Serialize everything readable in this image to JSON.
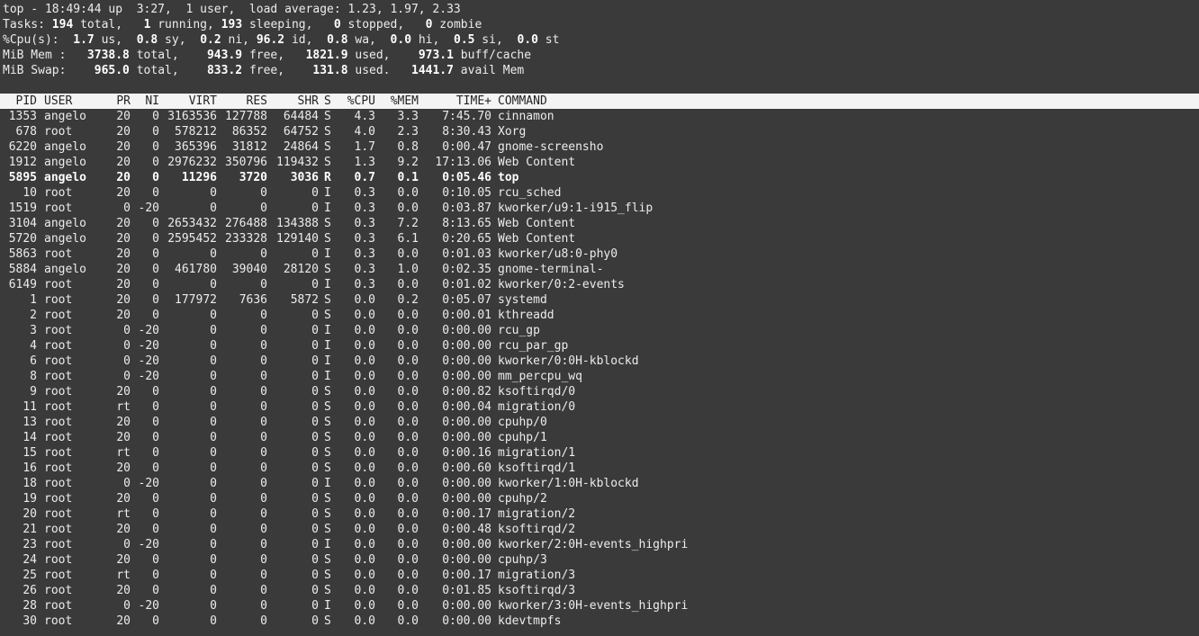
{
  "summary": {
    "top": "top - 18:49:44 up  3:27,  1 user,  load average: 1.23, 1.97, 2.33",
    "tasks": [
      {
        "t": "Tasks: ",
        "b": false
      },
      {
        "t": "194",
        "b": true
      },
      {
        "t": " total,   ",
        "b": false
      },
      {
        "t": "1",
        "b": true
      },
      {
        "t": " running, ",
        "b": false
      },
      {
        "t": "193",
        "b": true
      },
      {
        "t": " sleeping,   ",
        "b": false
      },
      {
        "t": "0",
        "b": true
      },
      {
        "t": " stopped,   ",
        "b": false
      },
      {
        "t": "0",
        "b": true
      },
      {
        "t": " zombie",
        "b": false
      }
    ],
    "cpu": [
      {
        "t": "%Cpu(s):  ",
        "b": false
      },
      {
        "t": "1.7",
        "b": true
      },
      {
        "t": " us,  ",
        "b": false
      },
      {
        "t": "0.8",
        "b": true
      },
      {
        "t": " sy,  ",
        "b": false
      },
      {
        "t": "0.2",
        "b": true
      },
      {
        "t": " ni, ",
        "b": false
      },
      {
        "t": "96.2",
        "b": true
      },
      {
        "t": " id,  ",
        "b": false
      },
      {
        "t": "0.8",
        "b": true
      },
      {
        "t": " wa,  ",
        "b": false
      },
      {
        "t": "0.0",
        "b": true
      },
      {
        "t": " hi,  ",
        "b": false
      },
      {
        "t": "0.5",
        "b": true
      },
      {
        "t": " si,  ",
        "b": false
      },
      {
        "t": "0.0",
        "b": true
      },
      {
        "t": " st",
        "b": false
      }
    ],
    "mem": [
      {
        "t": "MiB Mem :   ",
        "b": false
      },
      {
        "t": "3738.8",
        "b": true
      },
      {
        "t": " total,    ",
        "b": false
      },
      {
        "t": "943.9",
        "b": true
      },
      {
        "t": " free,   ",
        "b": false
      },
      {
        "t": "1821.9",
        "b": true
      },
      {
        "t": " used,    ",
        "b": false
      },
      {
        "t": "973.1",
        "b": true
      },
      {
        "t": " buff/cache",
        "b": false
      }
    ],
    "swap": [
      {
        "t": "MiB Swap:    ",
        "b": false
      },
      {
        "t": "965.0",
        "b": true
      },
      {
        "t": " total,    ",
        "b": false
      },
      {
        "t": "833.2",
        "b": true
      },
      {
        "t": " free,    ",
        "b": false
      },
      {
        "t": "131.8",
        "b": true
      },
      {
        "t": " used.   ",
        "b": false
      },
      {
        "t": "1441.7",
        "b": true
      },
      {
        "t": " avail Mem",
        "b": false
      }
    ]
  },
  "columns": {
    "pid": "PID",
    "user": "USER",
    "pr": "PR",
    "ni": "NI",
    "virt": "VIRT",
    "res": "RES",
    "shr": "SHR",
    "s": "S",
    "cpu": "%CPU",
    "mem": "%MEM",
    "time": "TIME+",
    "command": "COMMAND"
  },
  "processes": [
    {
      "pid": "1353",
      "user": "angelo",
      "pr": "20",
      "ni": "0",
      "virt": "3163536",
      "res": "127788",
      "shr": "64484",
      "s": "S",
      "cpu": "4.3",
      "mem": "3.3",
      "time": "7:45.70",
      "command": "cinnamon",
      "bold": false
    },
    {
      "pid": "678",
      "user": "root",
      "pr": "20",
      "ni": "0",
      "virt": "578212",
      "res": "86352",
      "shr": "64752",
      "s": "S",
      "cpu": "4.0",
      "mem": "2.3",
      "time": "8:30.43",
      "command": "Xorg",
      "bold": false
    },
    {
      "pid": "6220",
      "user": "angelo",
      "pr": "20",
      "ni": "0",
      "virt": "365396",
      "res": "31812",
      "shr": "24864",
      "s": "S",
      "cpu": "1.7",
      "mem": "0.8",
      "time": "0:00.47",
      "command": "gnome-screensho",
      "bold": false
    },
    {
      "pid": "1912",
      "user": "angelo",
      "pr": "20",
      "ni": "0",
      "virt": "2976232",
      "res": "350796",
      "shr": "119432",
      "s": "S",
      "cpu": "1.3",
      "mem": "9.2",
      "time": "17:13.06",
      "command": "Web Content",
      "bold": false
    },
    {
      "pid": "5895",
      "user": "angelo",
      "pr": "20",
      "ni": "0",
      "virt": "11296",
      "res": "3720",
      "shr": "3036",
      "s": "R",
      "cpu": "0.7",
      "mem": "0.1",
      "time": "0:05.46",
      "command": "top",
      "bold": true
    },
    {
      "pid": "10",
      "user": "root",
      "pr": "20",
      "ni": "0",
      "virt": "0",
      "res": "0",
      "shr": "0",
      "s": "I",
      "cpu": "0.3",
      "mem": "0.0",
      "time": "0:10.05",
      "command": "rcu_sched",
      "bold": false
    },
    {
      "pid": "1519",
      "user": "root",
      "pr": "0",
      "ni": "-20",
      "virt": "0",
      "res": "0",
      "shr": "0",
      "s": "I",
      "cpu": "0.3",
      "mem": "0.0",
      "time": "0:03.87",
      "command": "kworker/u9:1-i915_flip",
      "bold": false
    },
    {
      "pid": "3104",
      "user": "angelo",
      "pr": "20",
      "ni": "0",
      "virt": "2653432",
      "res": "276488",
      "shr": "134388",
      "s": "S",
      "cpu": "0.3",
      "mem": "7.2",
      "time": "8:13.65",
      "command": "Web Content",
      "bold": false
    },
    {
      "pid": "5720",
      "user": "angelo",
      "pr": "20",
      "ni": "0",
      "virt": "2595452",
      "res": "233328",
      "shr": "129140",
      "s": "S",
      "cpu": "0.3",
      "mem": "6.1",
      "time": "0:20.65",
      "command": "Web Content",
      "bold": false
    },
    {
      "pid": "5863",
      "user": "root",
      "pr": "20",
      "ni": "0",
      "virt": "0",
      "res": "0",
      "shr": "0",
      "s": "I",
      "cpu": "0.3",
      "mem": "0.0",
      "time": "0:01.03",
      "command": "kworker/u8:0-phy0",
      "bold": false
    },
    {
      "pid": "5884",
      "user": "angelo",
      "pr": "20",
      "ni": "0",
      "virt": "461780",
      "res": "39040",
      "shr": "28120",
      "s": "S",
      "cpu": "0.3",
      "mem": "1.0",
      "time": "0:02.35",
      "command": "gnome-terminal-",
      "bold": false
    },
    {
      "pid": "6149",
      "user": "root",
      "pr": "20",
      "ni": "0",
      "virt": "0",
      "res": "0",
      "shr": "0",
      "s": "I",
      "cpu": "0.3",
      "mem": "0.0",
      "time": "0:01.02",
      "command": "kworker/0:2-events",
      "bold": false
    },
    {
      "pid": "1",
      "user": "root",
      "pr": "20",
      "ni": "0",
      "virt": "177972",
      "res": "7636",
      "shr": "5872",
      "s": "S",
      "cpu": "0.0",
      "mem": "0.2",
      "time": "0:05.07",
      "command": "systemd",
      "bold": false
    },
    {
      "pid": "2",
      "user": "root",
      "pr": "20",
      "ni": "0",
      "virt": "0",
      "res": "0",
      "shr": "0",
      "s": "S",
      "cpu": "0.0",
      "mem": "0.0",
      "time": "0:00.01",
      "command": "kthreadd",
      "bold": false
    },
    {
      "pid": "3",
      "user": "root",
      "pr": "0",
      "ni": "-20",
      "virt": "0",
      "res": "0",
      "shr": "0",
      "s": "I",
      "cpu": "0.0",
      "mem": "0.0",
      "time": "0:00.00",
      "command": "rcu_gp",
      "bold": false
    },
    {
      "pid": "4",
      "user": "root",
      "pr": "0",
      "ni": "-20",
      "virt": "0",
      "res": "0",
      "shr": "0",
      "s": "I",
      "cpu": "0.0",
      "mem": "0.0",
      "time": "0:00.00",
      "command": "rcu_par_gp",
      "bold": false
    },
    {
      "pid": "6",
      "user": "root",
      "pr": "0",
      "ni": "-20",
      "virt": "0",
      "res": "0",
      "shr": "0",
      "s": "I",
      "cpu": "0.0",
      "mem": "0.0",
      "time": "0:00.00",
      "command": "kworker/0:0H-kblockd",
      "bold": false
    },
    {
      "pid": "8",
      "user": "root",
      "pr": "0",
      "ni": "-20",
      "virt": "0",
      "res": "0",
      "shr": "0",
      "s": "I",
      "cpu": "0.0",
      "mem": "0.0",
      "time": "0:00.00",
      "command": "mm_percpu_wq",
      "bold": false
    },
    {
      "pid": "9",
      "user": "root",
      "pr": "20",
      "ni": "0",
      "virt": "0",
      "res": "0",
      "shr": "0",
      "s": "S",
      "cpu": "0.0",
      "mem": "0.0",
      "time": "0:00.82",
      "command": "ksoftirqd/0",
      "bold": false
    },
    {
      "pid": "11",
      "user": "root",
      "pr": "rt",
      "ni": "0",
      "virt": "0",
      "res": "0",
      "shr": "0",
      "s": "S",
      "cpu": "0.0",
      "mem": "0.0",
      "time": "0:00.04",
      "command": "migration/0",
      "bold": false
    },
    {
      "pid": "13",
      "user": "root",
      "pr": "20",
      "ni": "0",
      "virt": "0",
      "res": "0",
      "shr": "0",
      "s": "S",
      "cpu": "0.0",
      "mem": "0.0",
      "time": "0:00.00",
      "command": "cpuhp/0",
      "bold": false
    },
    {
      "pid": "14",
      "user": "root",
      "pr": "20",
      "ni": "0",
      "virt": "0",
      "res": "0",
      "shr": "0",
      "s": "S",
      "cpu": "0.0",
      "mem": "0.0",
      "time": "0:00.00",
      "command": "cpuhp/1",
      "bold": false
    },
    {
      "pid": "15",
      "user": "root",
      "pr": "rt",
      "ni": "0",
      "virt": "0",
      "res": "0",
      "shr": "0",
      "s": "S",
      "cpu": "0.0",
      "mem": "0.0",
      "time": "0:00.16",
      "command": "migration/1",
      "bold": false
    },
    {
      "pid": "16",
      "user": "root",
      "pr": "20",
      "ni": "0",
      "virt": "0",
      "res": "0",
      "shr": "0",
      "s": "S",
      "cpu": "0.0",
      "mem": "0.0",
      "time": "0:00.60",
      "command": "ksoftirqd/1",
      "bold": false
    },
    {
      "pid": "18",
      "user": "root",
      "pr": "0",
      "ni": "-20",
      "virt": "0",
      "res": "0",
      "shr": "0",
      "s": "I",
      "cpu": "0.0",
      "mem": "0.0",
      "time": "0:00.00",
      "command": "kworker/1:0H-kblockd",
      "bold": false
    },
    {
      "pid": "19",
      "user": "root",
      "pr": "20",
      "ni": "0",
      "virt": "0",
      "res": "0",
      "shr": "0",
      "s": "S",
      "cpu": "0.0",
      "mem": "0.0",
      "time": "0:00.00",
      "command": "cpuhp/2",
      "bold": false
    },
    {
      "pid": "20",
      "user": "root",
      "pr": "rt",
      "ni": "0",
      "virt": "0",
      "res": "0",
      "shr": "0",
      "s": "S",
      "cpu": "0.0",
      "mem": "0.0",
      "time": "0:00.17",
      "command": "migration/2",
      "bold": false
    },
    {
      "pid": "21",
      "user": "root",
      "pr": "20",
      "ni": "0",
      "virt": "0",
      "res": "0",
      "shr": "0",
      "s": "S",
      "cpu": "0.0",
      "mem": "0.0",
      "time": "0:00.48",
      "command": "ksoftirqd/2",
      "bold": false
    },
    {
      "pid": "23",
      "user": "root",
      "pr": "0",
      "ni": "-20",
      "virt": "0",
      "res": "0",
      "shr": "0",
      "s": "I",
      "cpu": "0.0",
      "mem": "0.0",
      "time": "0:00.00",
      "command": "kworker/2:0H-events_highpri",
      "bold": false
    },
    {
      "pid": "24",
      "user": "root",
      "pr": "20",
      "ni": "0",
      "virt": "0",
      "res": "0",
      "shr": "0",
      "s": "S",
      "cpu": "0.0",
      "mem": "0.0",
      "time": "0:00.00",
      "command": "cpuhp/3",
      "bold": false
    },
    {
      "pid": "25",
      "user": "root",
      "pr": "rt",
      "ni": "0",
      "virt": "0",
      "res": "0",
      "shr": "0",
      "s": "S",
      "cpu": "0.0",
      "mem": "0.0",
      "time": "0:00.17",
      "command": "migration/3",
      "bold": false
    },
    {
      "pid": "26",
      "user": "root",
      "pr": "20",
      "ni": "0",
      "virt": "0",
      "res": "0",
      "shr": "0",
      "s": "S",
      "cpu": "0.0",
      "mem": "0.0",
      "time": "0:01.85",
      "command": "ksoftirqd/3",
      "bold": false
    },
    {
      "pid": "28",
      "user": "root",
      "pr": "0",
      "ni": "-20",
      "virt": "0",
      "res": "0",
      "shr": "0",
      "s": "I",
      "cpu": "0.0",
      "mem": "0.0",
      "time": "0:00.00",
      "command": "kworker/3:0H-events_highpri",
      "bold": false
    },
    {
      "pid": "30",
      "user": "root",
      "pr": "20",
      "ni": "0",
      "virt": "0",
      "res": "0",
      "shr": "0",
      "s": "S",
      "cpu": "0.0",
      "mem": "0.0",
      "time": "0:00.00",
      "command": "kdevtmpfs",
      "bold": false
    }
  ],
  "colors": {
    "background": "#3a3a3a",
    "text": "#ececec",
    "header_bg": "#f4f4f4",
    "header_text": "#222222"
  }
}
